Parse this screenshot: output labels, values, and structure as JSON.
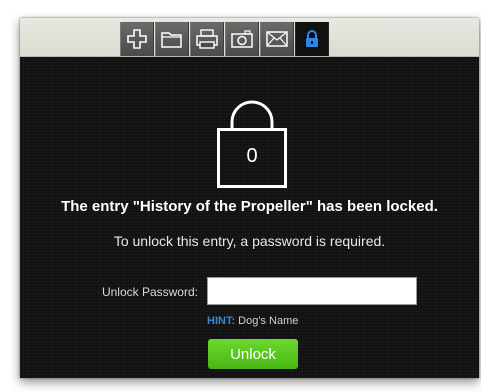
{
  "toolbar": {
    "buttons": [
      {
        "icon": "plus-icon",
        "label": "Add"
      },
      {
        "icon": "folder-icon",
        "label": "Folder"
      },
      {
        "icon": "printer-icon",
        "label": "Print"
      },
      {
        "icon": "camera-icon",
        "label": "Camera"
      },
      {
        "icon": "envelope-icon",
        "label": "Mail"
      },
      {
        "icon": "lock-icon",
        "label": "Lock",
        "active": true
      }
    ],
    "active_color": "#2f86e6"
  },
  "lock": {
    "number": "0",
    "message": "The entry \"History of the Propeller\" has been locked.",
    "instruction": "To unlock this entry, a password is required."
  },
  "form": {
    "password_label": "Unlock Password:",
    "password_value": "",
    "hint_label": "HINT:",
    "hint_text": "Dog's Name",
    "unlock_label": "Unlock"
  },
  "colors": {
    "background": "#111111",
    "button_green": "#55c41e",
    "hint_blue": "#3b86d6"
  }
}
